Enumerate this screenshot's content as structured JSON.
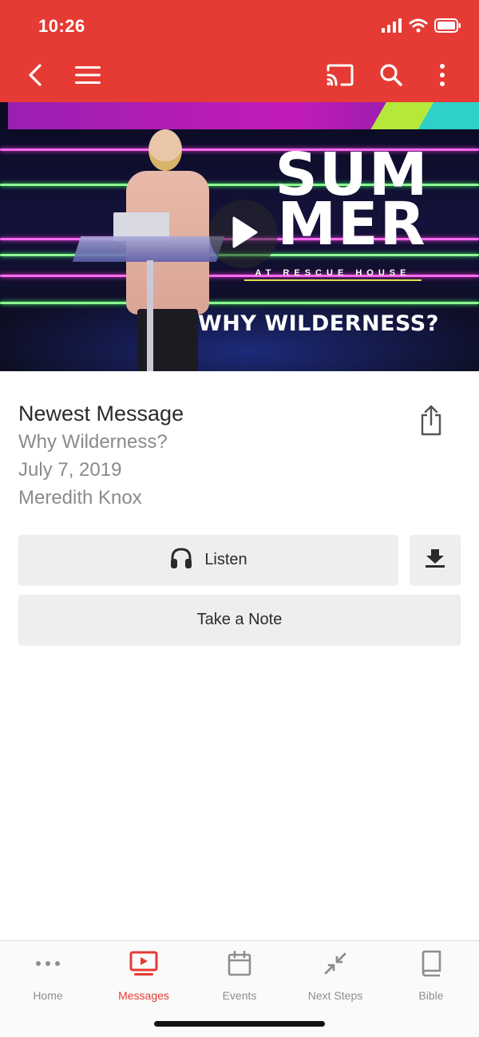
{
  "status_bar": {
    "time": "10:26"
  },
  "header": {
    "back_icon": "chevron-left-icon",
    "menu_icon": "hamburger-menu-icon",
    "cast_icon": "cast-icon",
    "search_icon": "search-icon",
    "more_icon": "more-vertical-icon",
    "background_color": "#e53b34"
  },
  "video": {
    "title_graphic_line1": "SUM",
    "title_graphic_line2": "MER",
    "subtitle_graphic": "AT RESCUE HOUSE",
    "caption_graphic": "WHY WILDERNESS?",
    "play_icon": "play-icon"
  },
  "message": {
    "heading": "Newest Message",
    "title": "Why Wilderness?",
    "date": "July 7, 2019",
    "speaker": "Meredith Knox",
    "share_icon": "share-icon"
  },
  "actions": {
    "listen_label": "Listen",
    "listen_icon": "headphones-icon",
    "download_icon": "download-icon",
    "note_label": "Take a Note"
  },
  "tabbar": {
    "active_color": "#e53b34",
    "items": [
      {
        "label": "Home",
        "icon": "more-horizontal-icon",
        "active": false
      },
      {
        "label": "Messages",
        "icon": "video-play-icon",
        "active": true
      },
      {
        "label": "Events",
        "icon": "calendar-icon",
        "active": false
      },
      {
        "label": "Next Steps",
        "icon": "arrows-in-icon",
        "active": false
      },
      {
        "label": "Bible",
        "icon": "book-icon",
        "active": false
      }
    ]
  }
}
